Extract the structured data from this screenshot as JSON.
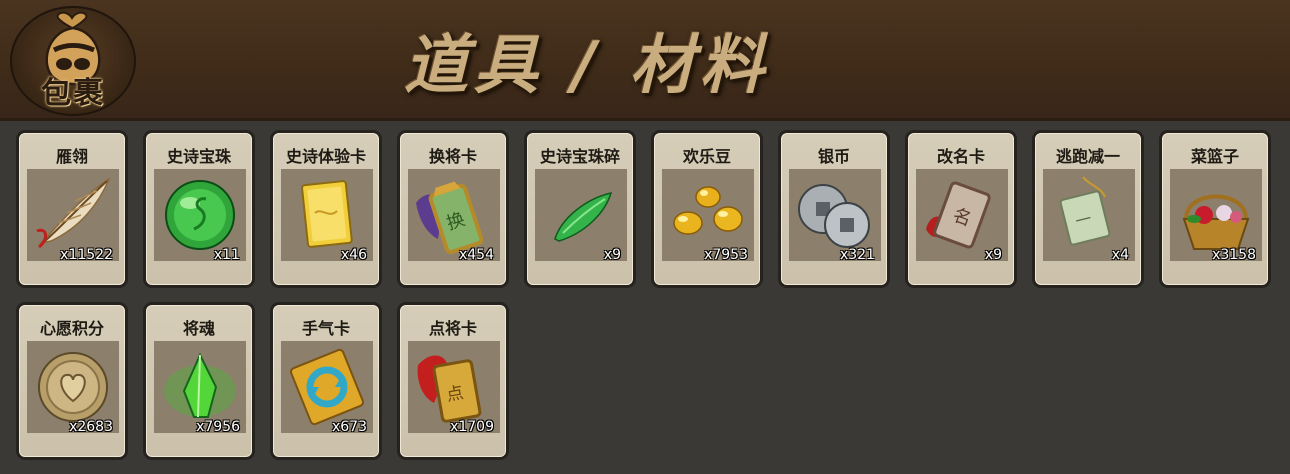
{
  "header": {
    "bag_label": "包裹",
    "title": "道具 / 材料"
  },
  "items": [
    {
      "name": "雁翎",
      "count": "x11522",
      "icon": "feather-icon"
    },
    {
      "name": "史诗宝珠",
      "count": "x11",
      "icon": "green-orb-icon"
    },
    {
      "name": "史诗体验卡",
      "count": "x46",
      "icon": "gold-card-icon"
    },
    {
      "name": "换将卡",
      "count": "x454",
      "icon": "jade-token-icon"
    },
    {
      "name": "史诗宝珠碎",
      "count": "x9",
      "icon": "jade-shard-icon"
    },
    {
      "name": "欢乐豆",
      "count": "x7953",
      "icon": "gold-beans-icon"
    },
    {
      "name": "银币",
      "count": "x321",
      "icon": "silver-coins-icon"
    },
    {
      "name": "改名卡",
      "count": "x9",
      "icon": "name-tag-icon"
    },
    {
      "name": "逃跑减一",
      "count": "x4",
      "icon": "jade-tablet-icon"
    },
    {
      "name": "菜篮子",
      "count": "x3158",
      "icon": "flower-basket-icon"
    },
    {
      "name": "心愿积分",
      "count": "x2683",
      "icon": "heart-coin-icon"
    },
    {
      "name": "将魂",
      "count": "x7956",
      "icon": "green-crystal-icon"
    },
    {
      "name": "手气卡",
      "count": "x673",
      "icon": "refresh-card-icon"
    },
    {
      "name": "点将卡",
      "count": "x1709",
      "icon": "red-plume-token-icon"
    }
  ]
}
